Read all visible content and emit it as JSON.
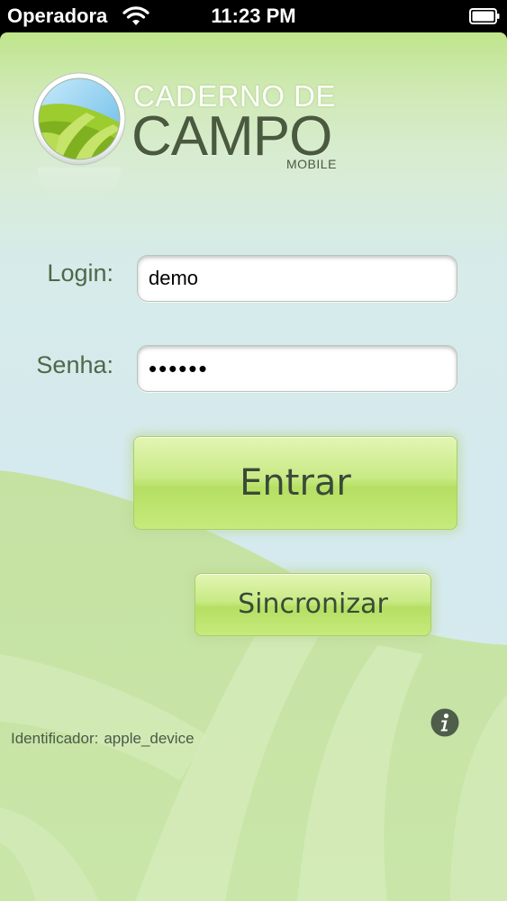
{
  "status_bar": {
    "carrier": "Operadora",
    "time": "11:23 PM",
    "wifi_icon": "wifi-icon",
    "battery_icon": "battery-icon"
  },
  "logo": {
    "line1": "CADERNO DE",
    "line2": "CAMPO",
    "line3": "MOBILE",
    "icon": "globe-logo-icon"
  },
  "form": {
    "login_label": "Login:",
    "login_value": "demo",
    "password_label": "Senha:",
    "password_value": "••••••"
  },
  "buttons": {
    "enter_label": "Entrar",
    "sync_label": "Sincronizar"
  },
  "footer": {
    "identifier_label": "Identificador:",
    "identifier_value": "apple_device",
    "info_icon": "info-icon"
  },
  "colors": {
    "button_green": "#c8ea84",
    "text_dark": "#4a5a3e",
    "background_blue": "#d5eaee",
    "hill_green": "#c6e3a4"
  }
}
